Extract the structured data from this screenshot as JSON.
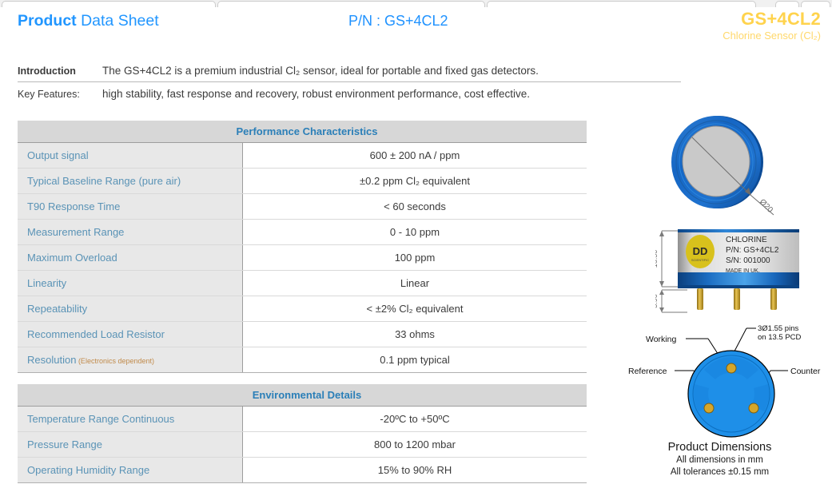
{
  "browser": {
    "tabs": [
      "",
      "",
      "",
      ""
    ]
  },
  "header": {
    "title_bold": "Product",
    "title_rest": " Data Sheet",
    "part_number": "P/N : GS+4CL2",
    "product_name": "GS+4CL2",
    "product_subtitle": "Chlorine Sensor (Cl₂)",
    "accent_blue": "#2196ff",
    "accent_yellow": "#ffd34d"
  },
  "intro": {
    "label": "Introduction",
    "text": "The GS+4CL2 is a premium industrial Cl₂ sensor, ideal for portable and fixed gas detectors.",
    "features_label": "Key Features:",
    "features_text": "high stability, fast response and recovery, robust environment performance, cost effective."
  },
  "performance": {
    "heading": "Performance Characteristics",
    "rows": [
      {
        "key": "Output signal",
        "note": "",
        "value": "600 ± 200 nA / ppm"
      },
      {
        "key": "Typical Baseline Range (pure air)",
        "note": "",
        "value": "±0.2 ppm Cl₂ equivalent"
      },
      {
        "key": "T90 Response Time",
        "note": "",
        "value": "< 60 seconds"
      },
      {
        "key": "Measurement Range",
        "note": "",
        "value": "0 - 10 ppm"
      },
      {
        "key": "Maximum Overload",
        "note": "",
        "value": "100 ppm"
      },
      {
        "key": "Linearity",
        "note": "",
        "value": "Linear"
      },
      {
        "key": "Repeatability",
        "note": "",
        "value": "< ±2% Cl₂ equivalent"
      },
      {
        "key": "Recommended Load Resistor",
        "note": "",
        "value": "33 ohms"
      },
      {
        "key": "Resolution",
        "note": " (Electronics dependent)",
        "value": "0.1 ppm typical"
      }
    ]
  },
  "environmental": {
    "heading": "Environmental Details",
    "rows": [
      {
        "key": "Temperature Range Continuous",
        "note": "",
        "value": "-20ºC to +50ºC"
      },
      {
        "key": "Pressure Range",
        "note": "",
        "value": "800 to 1200 mbar"
      },
      {
        "key": "Operating Humidity Range",
        "note": "",
        "value": "15% to 90% RH"
      }
    ]
  },
  "figures": {
    "top_view": {
      "diameter_label": "Ø20"
    },
    "side_view": {
      "height_label": "16.50",
      "pin_label": "3.90",
      "badge_text": "DD",
      "badge_sub": "SCIENTIFIC",
      "label_lines": [
        "CHLORINE",
        "P/N: GS+4CL2",
        "S/N:  001000",
        "MADE IN UK."
      ]
    },
    "bottom_view": {
      "callout_working": "Working",
      "callout_reference": "Reference",
      "callout_counter": "Counter",
      "pin_spec_line1": "3Ø1.55 pins",
      "pin_spec_line2": "on 13.5 PCD"
    },
    "caption_title": "Product Dimensions",
    "caption_line1": "All dimensions in mm",
    "caption_line2": "All tolerances ±0.15 mm"
  }
}
